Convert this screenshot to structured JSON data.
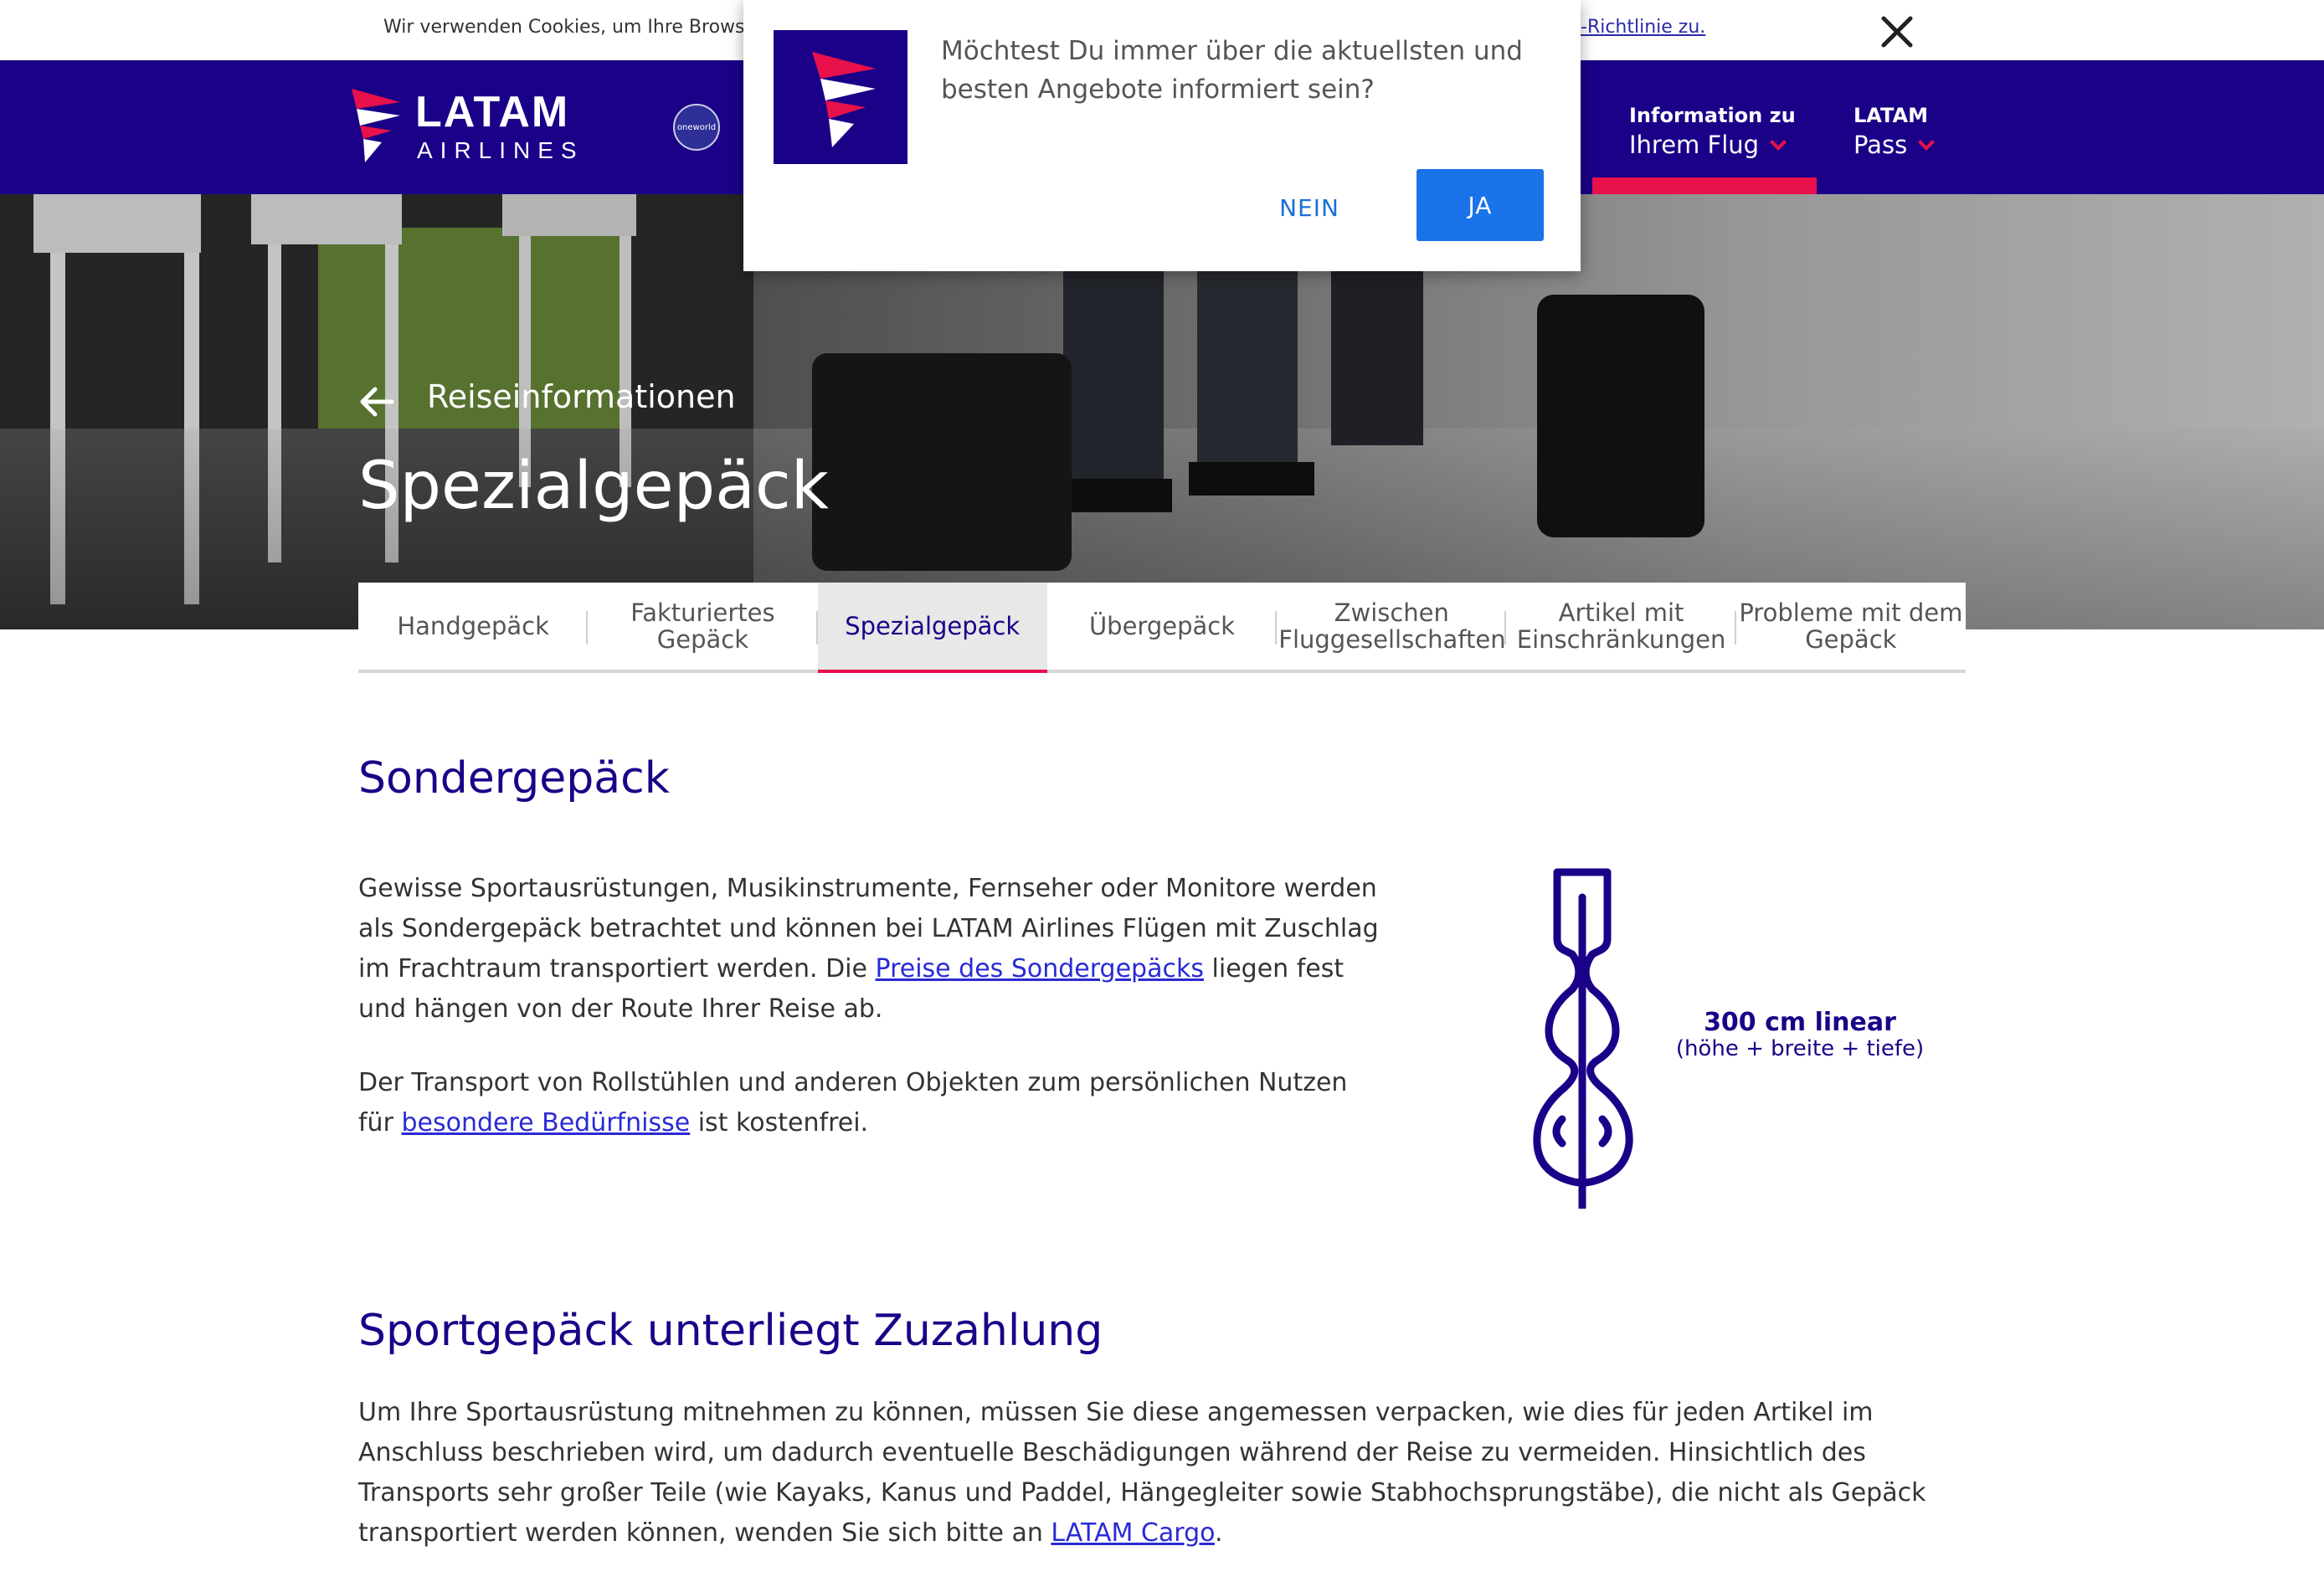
{
  "cookie_bar": {
    "text": "Wir verwenden Cookies, um Ihre Browser-",
    "link": "-Richtlinie zu.",
    "close_icon": "close-icon"
  },
  "header": {
    "logo_word": "LATAM",
    "logo_sub": "AIRLINES",
    "alliance_badge": "oneworld",
    "nav": [
      {
        "line1": "Information zu",
        "line2": "Ihrem Flug",
        "active": true
      },
      {
        "line1": "LATAM",
        "line2": "Pass",
        "active": false
      }
    ],
    "accent_color": "#e8114b",
    "brand_color": "#1b0088"
  },
  "hero": {
    "breadcrumb": "Reiseinformationen",
    "title": "Spezialgepäck"
  },
  "tabs": [
    {
      "label": "Handgepäck",
      "active": false
    },
    {
      "label": "Fakturiertes Gepäck",
      "active": false
    },
    {
      "label": "Spezialgepäck",
      "active": true
    },
    {
      "label": "Übergepäck",
      "active": false
    },
    {
      "label": "Zwischen Fluggesellschaften",
      "active": false
    },
    {
      "label": "Artikel mit Einschränkungen",
      "active": false
    },
    {
      "label": "Probleme mit dem Gepäck",
      "active": false
    }
  ],
  "section1": {
    "heading": "Sondergepäck",
    "p1_before": "Gewisse Sportausrüstungen, Musikinstrumente, Fernseher oder Monitore werden als Sondergepäck betrachtet und können bei LATAM Airlines Flügen mit Zuschlag im Frachtraum transportiert werden. Die ",
    "p1_link": "Preise des Sondergepäcks",
    "p1_after": " liegen fest und hängen von der Route Ihrer Reise ab.",
    "p2_before": "Der Transport von Rollstühlen und anderen Objekten zum persönlichen Nutzen für ",
    "p2_link": "besondere Bedürfnisse",
    "p2_after": " ist kostenfrei.",
    "illustration_line1": "300 cm linear",
    "illustration_line2": "(höhe + breite + tiefe)"
  },
  "section2": {
    "heading": "Sportgepäck unterliegt Zuzahlung",
    "p_before": "Um Ihre Sportausrüstung mitnehmen zu können, müssen Sie diese angemessen verpacken, wie dies für jeden Artikel im Anschluss beschrieben wird, um dadurch eventuelle Beschädigungen während der Reise zu vermeiden. Hinsichtlich des Transports sehr großer Teile (wie Kayaks, Kanus und Paddel, Hängegleiter sowie Stabhochsprungstäbe), die nicht als Gepäck transportiert werden können, wenden Sie sich bitte an ",
    "p_link": "LATAM Cargo",
    "p_after": "."
  },
  "popup": {
    "message": "Möchtest Du immer über die aktuellsten und besten Angebote informiert sein?",
    "no_label": "NEIN",
    "yes_label": "JA",
    "button_color": "#1a73e8"
  }
}
